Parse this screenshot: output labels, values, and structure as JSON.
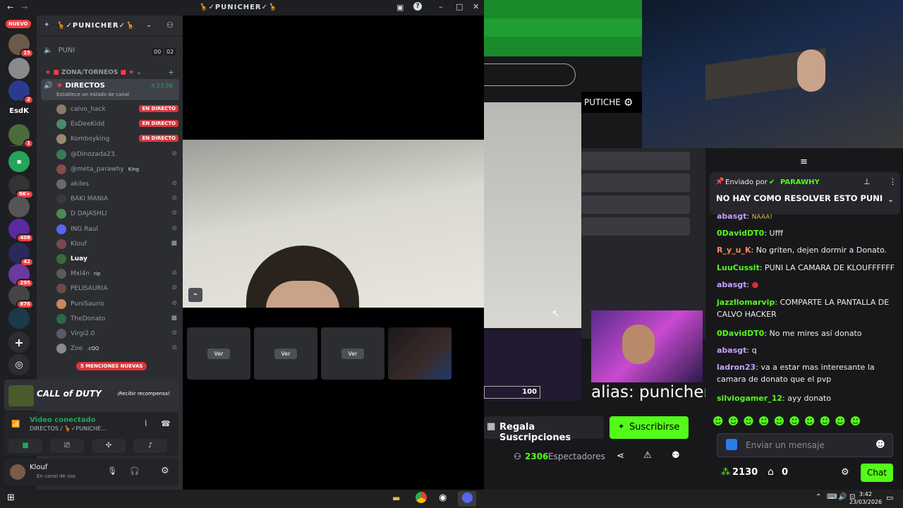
{
  "discord": {
    "title": "🦒✓PUNICHER✓🦒",
    "server_name": "🦒✓PUNICHER✓🦒",
    "new_label": "NUEVO",
    "rail_badges": [
      "15",
      "2",
      "1",
      "9K+",
      "408",
      "42",
      "295",
      "876"
    ],
    "rail_text_server": "EsdK",
    "user_count": {
      "a": "00",
      "b": "02"
    },
    "puni_channel": "PUNI",
    "category": "ZONA/TORNEOS",
    "voice_channel": {
      "name": "DIRECTOS",
      "timer": "4:23:56",
      "status": "Establece un estado de canal"
    },
    "members": [
      {
        "name": "calvo_hack",
        "tag": "EN DIRECTO"
      },
      {
        "name": "EsDeeKidd",
        "tag": "EN DIRECTO"
      },
      {
        "name": "Komboyking",
        "tag": "EN DIRECTO"
      },
      {
        "name": "@Dinozada23.",
        "tag": ""
      },
      {
        "name": "@meta_parawhy",
        "tag": "King"
      },
      {
        "name": "akiles",
        "tag": ""
      },
      {
        "name": "BAKI MANIA",
        "tag": ""
      },
      {
        "name": "D DAJASHLI",
        "tag": ""
      },
      {
        "name": "ING Raul",
        "tag": ""
      },
      {
        "name": "Klouf",
        "tag": ""
      },
      {
        "name": "Luay",
        "tag": ""
      },
      {
        "name": "Mxl4n",
        "tag": "rip"
      },
      {
        "name": "PELISAURIA",
        "tag": ""
      },
      {
        "name": "PuniSaurio",
        "tag": ""
      },
      {
        "name": "TheDonato",
        "tag": ""
      },
      {
        "name": "Virgi2.0",
        "tag": ""
      },
      {
        "name": "Zoe",
        "tag": ".cQQ"
      }
    ],
    "mentions": "5 MENCIONES NUEVAS",
    "promo": {
      "game": "CALL of DUTY",
      "action": "¡Recibir recompensa!"
    },
    "connection": {
      "status": "Video conectado",
      "channel": "DIRECTOS / 🦒✓PUNICHE..."
    },
    "user": {
      "name": "Klouf",
      "status": "En canal de voz"
    },
    "ver_label": "Ver"
  },
  "stream": {
    "streamer_label": "PUTICHE",
    "alias": "alias: punicher",
    "counter": "100",
    "gift_button": "Regala Suscripciones",
    "subscribe_button": "Suscribirse",
    "viewers": "2306",
    "viewers_label": "Espectadores"
  },
  "chat": {
    "pinned": {
      "by_label": "Enviado por",
      "user": "PARAWHY",
      "text": "NO HAY COMO RESOLVER ESTO PUNI"
    },
    "messages": [
      {
        "user": "abasgt",
        "text": "NAAA!",
        "color": "#c4a1ff"
      },
      {
        "user": "0DavidDT0",
        "text": "Ufff",
        "color": "#53fc18"
      },
      {
        "user": "R_y_u_K",
        "text": "No griten, dejen dormir a Donato.",
        "color": "#ff8c5a"
      },
      {
        "user": "LuuCussit",
        "text": "PUNI LA CAMARA DE KLOUFFFFFF",
        "color": "#53fc18"
      },
      {
        "user": "abasgt",
        "text": "",
        "color": "#c4a1ff"
      },
      {
        "user": "jazzllomarvip",
        "text": "COMPARTE LA PANTALLA DE CALVO HACKER",
        "color": "#53fc18"
      },
      {
        "user": "0DavidDT0",
        "text": "No me mires así donato",
        "color": "#53fc18"
      },
      {
        "user": "abasgt",
        "text": "q",
        "color": "#c4a1ff"
      },
      {
        "user": "ladron23",
        "text": "va a estar mas interesante la camara de donato que el pvp",
        "color": "#c4a1ff"
      },
      {
        "user": "silviogamer_12",
        "text": "ayy donato",
        "color": "#53fc18"
      }
    ],
    "input_placeholder": "Enviar un mensaje",
    "points": "2130",
    "store_count": "0",
    "chat_button": "Chat",
    "accent": "#53fc18"
  },
  "taskbar": {
    "time": "3:42",
    "date": "23/03/2026"
  }
}
